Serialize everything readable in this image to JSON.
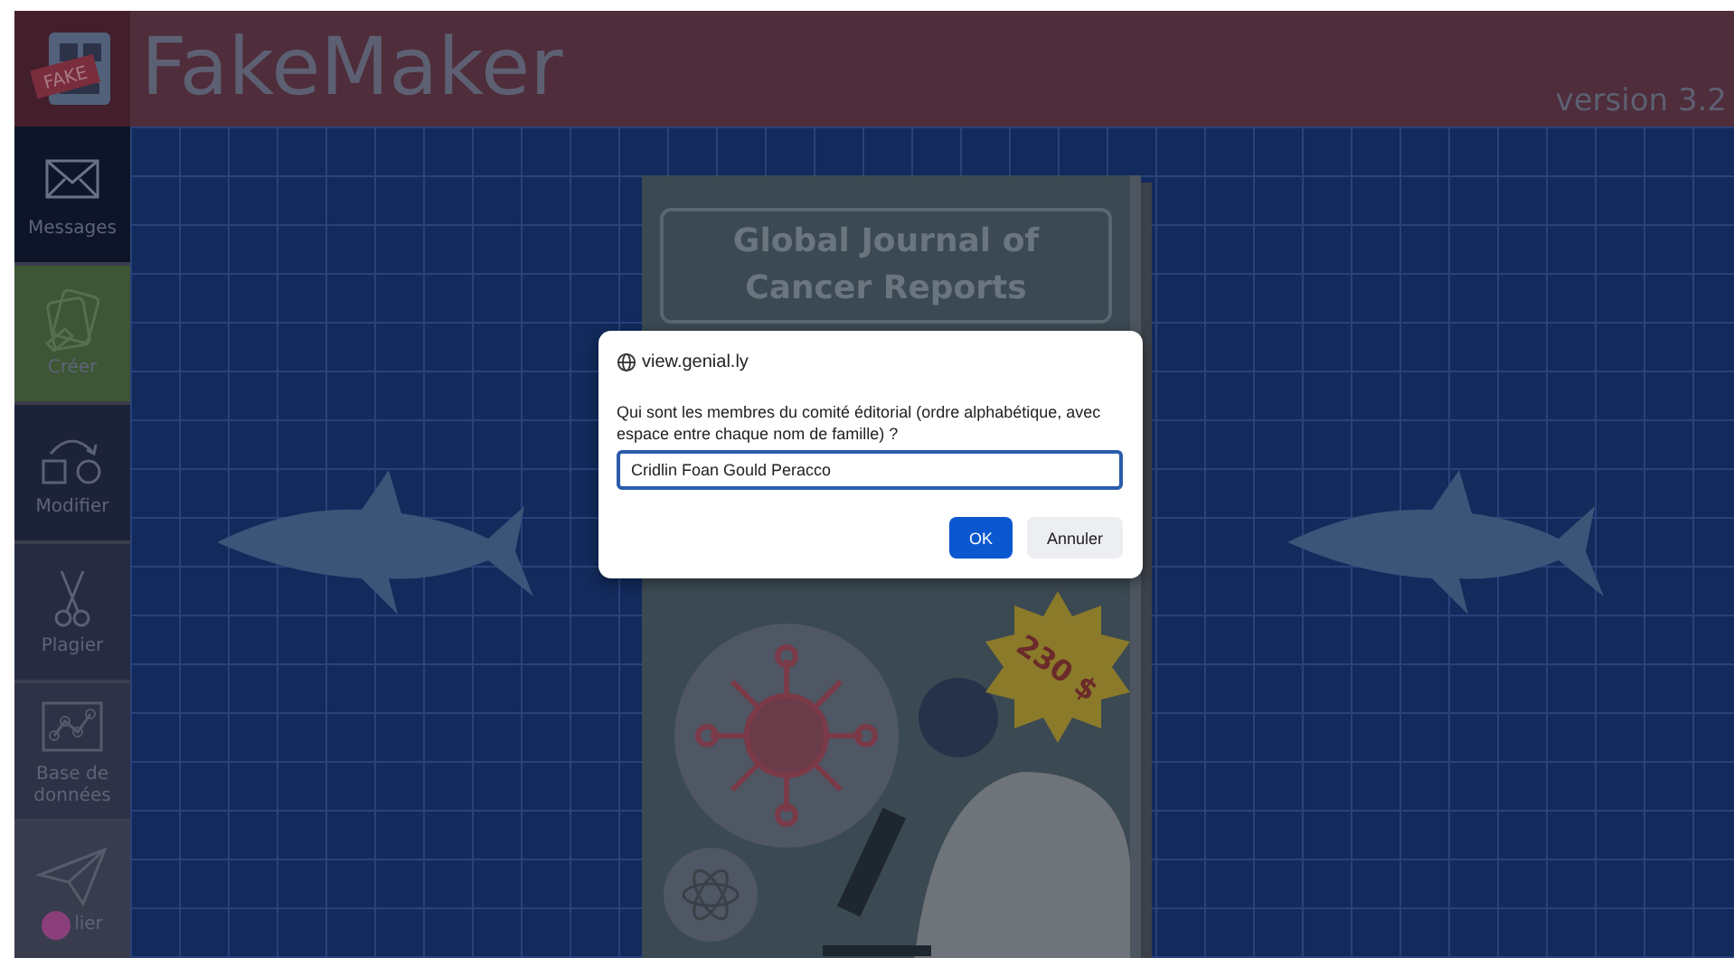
{
  "header": {
    "logo_badge": "FAKE",
    "title": "FakeMaker",
    "version": "version 3.2"
  },
  "sidebar": {
    "items": [
      {
        "label": "Messages",
        "kind": "envelope",
        "color": "#0e1529"
      },
      {
        "label": "Créer",
        "kind": "documents",
        "color": "#3d5636"
      },
      {
        "label": "Modifier",
        "kind": "transform",
        "color": "#1c2238"
      },
      {
        "label": "Plagier",
        "kind": "scissors",
        "color": "#262b42"
      },
      {
        "label": "Base de données",
        "kind": "chart",
        "color": "#2e3246"
      },
      {
        "label": "lier",
        "kind": "plane",
        "color": "#383c4d"
      }
    ]
  },
  "cover": {
    "title": "Global Journal of Cancer Reports",
    "price": "230 $"
  },
  "dialog": {
    "origin": "view.genial.ly",
    "message": "Qui sont les membres du comité éditorial (ordre alphabétique, avec espace entre chaque nom de famille) ?",
    "value": "Cridlin Foan Gould Peracco",
    "buttons": [
      {
        "label": "OK",
        "primary": true
      },
      {
        "label": "Annuler",
        "primary": false
      }
    ]
  }
}
